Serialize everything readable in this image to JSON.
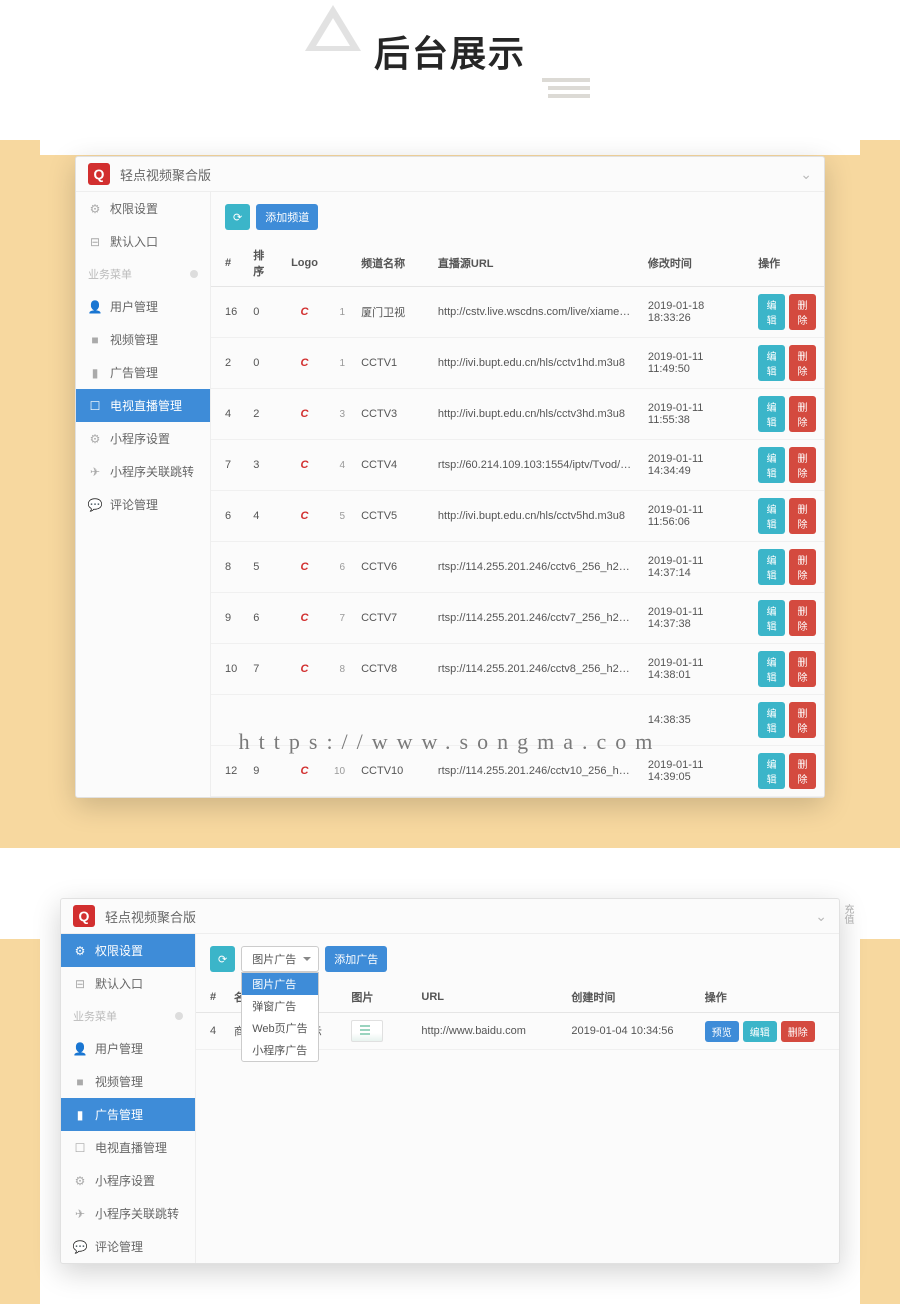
{
  "hero_title": "后台展示",
  "watermark": "https://www.songma.com",
  "panel1": {
    "title": "轻点视频聚合版",
    "sidebar_line1": [
      {
        "icon": "gear",
        "label": "权限设置"
      },
      {
        "icon": "door",
        "label": "默认入口"
      }
    ],
    "sidebar_group": "业务菜单",
    "sidebar_line2": [
      {
        "icon": "user",
        "label": "用户管理"
      },
      {
        "icon": "video",
        "label": "视频管理"
      },
      {
        "icon": "ad",
        "label": "广告管理"
      },
      {
        "icon": "tv",
        "label": "电视直播管理",
        "active": true
      },
      {
        "icon": "gear",
        "label": "小程序设置"
      },
      {
        "icon": "rocket",
        "label": "小程序关联跳转"
      },
      {
        "icon": "comment",
        "label": "评论管理"
      }
    ],
    "add_button": "添加频道",
    "columns": [
      "#",
      "排序",
      "Logo",
      "",
      "频道名称",
      "直播源URL",
      "修改时间",
      "操作"
    ],
    "op_edit": "编辑",
    "op_del": "删除",
    "rows": [
      {
        "idx": "16",
        "sort": "0",
        "n": "1",
        "name": "厦门卫视",
        "url": "http://cstv.live.wscdns.com/live/xiamen/playli...",
        "time": "2019-01-18 18:33:26"
      },
      {
        "idx": "2",
        "sort": "0",
        "n": "1",
        "name": "CCTV1",
        "url": "http://ivi.bupt.edu.cn/hls/cctv1hd.m3u8",
        "time": "2019-01-11 11:49:50"
      },
      {
        "idx": "4",
        "sort": "2",
        "n": "3",
        "name": "CCTV3",
        "url": "http://ivi.bupt.edu.cn/hls/cctv3hd.m3u8",
        "time": "2019-01-11 11:55:38"
      },
      {
        "idx": "7",
        "sort": "3",
        "n": "4",
        "name": "CCTV4",
        "url": "rtsp://60.214.109.103:1554/iptv/Tvod/iptv/00...",
        "time": "2019-01-11 14:34:49"
      },
      {
        "idx": "6",
        "sort": "4",
        "n": "5",
        "name": "CCTV5",
        "url": "http://ivi.bupt.edu.cn/hls/cctv5hd.m3u8",
        "time": "2019-01-11 11:56:06"
      },
      {
        "idx": "8",
        "sort": "5",
        "n": "6",
        "name": "CCTV6",
        "url": "rtsp://114.255.201.246/cctv6_256_h264.sdp?...",
        "time": "2019-01-11 14:37:14"
      },
      {
        "idx": "9",
        "sort": "6",
        "n": "7",
        "name": "CCTV7",
        "url": "rtsp://114.255.201.246/cctv7_256_h264.sdp?u...",
        "time": "2019-01-11 14:37:38"
      },
      {
        "idx": "10",
        "sort": "7",
        "n": "8",
        "name": "CCTV8",
        "url": "rtsp://114.255.201.246/cctv8_256_h264.sdp?u...",
        "time": "2019-01-11 14:38:01"
      },
      {
        "idx": "",
        "sort": "",
        "n": "",
        "name": "",
        "url": "",
        "time": "14:38:35"
      },
      {
        "idx": "12",
        "sort": "9",
        "n": "10",
        "name": "CCTV10",
        "url": "rtsp://114.255.201.246/cctv10_256_h264.sdp?...",
        "time": "2019-01-11 14:39:05"
      }
    ]
  },
  "panel2": {
    "title": "轻点视频聚合版",
    "side_tag": "充值",
    "sidebar_line1": [
      {
        "icon": "gear",
        "label": "权限设置",
        "active": true
      },
      {
        "icon": "door",
        "label": "默认入口"
      }
    ],
    "sidebar_group": "业务菜单",
    "sidebar_line2": [
      {
        "icon": "user",
        "label": "用户管理"
      },
      {
        "icon": "video",
        "label": "视频管理"
      },
      {
        "icon": "ad",
        "label": "广告管理",
        "active": true
      },
      {
        "icon": "tv",
        "label": "电视直播管理"
      },
      {
        "icon": "gear",
        "label": "小程序设置"
      },
      {
        "icon": "rocket",
        "label": "小程序关联跳转"
      },
      {
        "icon": "comment",
        "label": "评论管理"
      }
    ],
    "dropdown_value": "图片广告",
    "dropdown_items": [
      "图片广告",
      "弹窗广告",
      "Web页广告",
      "小程序广告"
    ],
    "add_button": "添加广告",
    "columns": [
      "#",
      "名",
      "图片",
      "URL",
      "创建时间",
      "操作"
    ],
    "op_pre": "预览",
    "op_edit": "编辑",
    "op_del": "删除",
    "rows": [
      {
        "idx": "4",
        "name": "商品图片广告显示",
        "url": "http://www.baidu.com",
        "time": "2019-01-04 10:34:56"
      }
    ]
  }
}
